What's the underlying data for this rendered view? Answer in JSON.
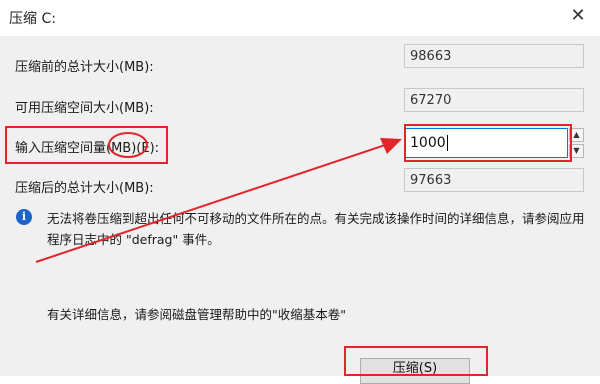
{
  "window": {
    "title": "压缩 C:",
    "close_glyph": "✕"
  },
  "fields": {
    "before_label": "压缩前的总计大小(MB):",
    "before_value": "98663",
    "available_label": "可用压缩空间大小(MB):",
    "available_value": "67270",
    "input_label": "输入压缩空间量(MB)(E):",
    "input_value": "1000",
    "after_label": "压缩后的总计大小(MB):",
    "after_value": "97663"
  },
  "spinner": {
    "up_glyph": "▲",
    "down_glyph": "▼"
  },
  "info": {
    "icon": "i",
    "text": "无法将卷压缩到超出任何不可移动的文件所在的点。有关完成该操作时间的详细信息，请参阅应用程序日志中的 \"defrag\" 事件。"
  },
  "more_info": "有关详细信息，请参阅磁盘管理帮助中的\"收缩基本卷\"",
  "buttons": {
    "shrink_label": "压缩(S)"
  },
  "annotation_colors": {
    "highlight": "#e0262a"
  }
}
